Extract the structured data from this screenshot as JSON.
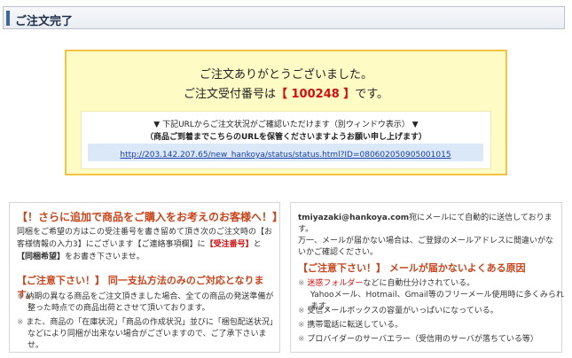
{
  "header": {
    "title": "ご注文完了"
  },
  "confirm": {
    "thanks": "ご注文ありがとうございました。",
    "order_prefix": "ご注文受付番号は",
    "order_number": "【 100248 】",
    "order_suffix": "です。",
    "note1": "▼ 下記URLからご注文状況がご確認いただけます（別ウィンドウ表示） ▼",
    "note2": "（商品ご到着までこちらのURLを保管くださいますようお願い申し上げます）",
    "url": "http://203.142.207.65/new_hankoya/status/status.html?ID=080602050905001015"
  },
  "left": {
    "title": "【！さらに追加で商品をご購入をお考えのお客様へ！】",
    "body_1": "同梱をご希望の方はこの受注番号を書き留めて頂き次のご注文時の【お客様情報の入力3】にございます【ご連絡事項欄】に",
    "body_red": "【受注番号】",
    "body_2": "と",
    "body_bold": "【同梱希望】",
    "body_3": "をお書き下さいませ。",
    "sub_title": "【ご注意下さい！】 同一支払方法のみのご対応となります。",
    "mark": "※",
    "item1": "納期の異なる商品をご注文頂きました場合、全ての商品の発送準備が整った時点での商品出荷とさせて頂いております。",
    "item2": "また、商品の「在庫状況」「商品の作成状況」並びに「梱包配送状況」などにより同梱が出来ない場合がございますので、ご了承下さいませ。"
  },
  "right": {
    "email": "tmiyazaki@hankoya.com",
    "intro": "宛にメールにて自動的に送信しております。",
    "intro2": "万一、メールが届かない場合は、ご登録のメールアドレスに間違いがないかご確認ください。",
    "title": "【ご注意下さい！】 メールが届かないよくある原因",
    "mark": "※",
    "item1_red": "迷惑フォルダー",
    "item1_rest": "などに自動仕分けされている。",
    "item1_sub": "Yahooメール、Hotmail、Gmail等のフリーメール使用時に多くみられます。",
    "item2": "受信メールボックスの容量がいっぱいになっている。",
    "item3": "携帯電話に転送している。",
    "item4": "プロバイダーのサーバエラー（受信用のサーバが落ちている等）"
  }
}
